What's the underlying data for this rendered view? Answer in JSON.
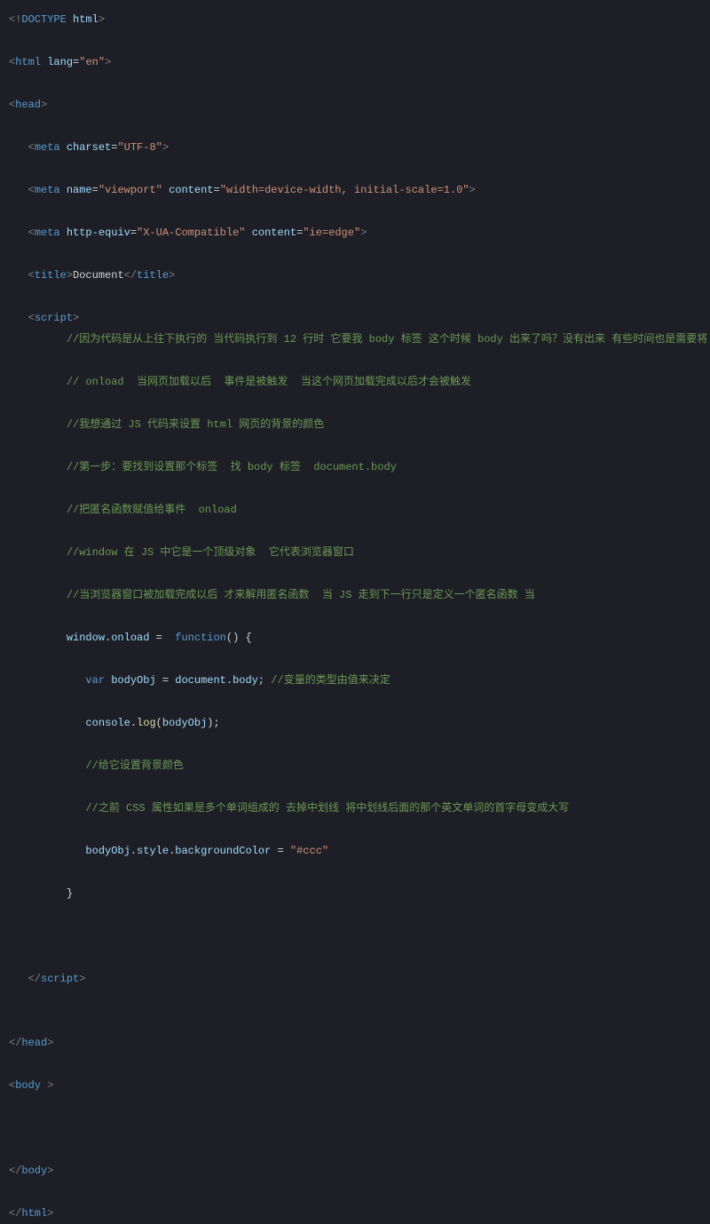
{
  "code": {
    "doctype": "html",
    "html_lang": "en",
    "head": "head",
    "meta1_attr": "charset",
    "meta1_val": "UTF-8",
    "meta2_name": "name",
    "meta2_name_val": "viewport",
    "meta2_content": "content",
    "meta2_content_val": "width=device-width, initial-scale=1.0",
    "meta3_equiv": "http-equiv",
    "meta3_equiv_val": "X-UA-Compatible",
    "meta3_content": "content",
    "meta3_content_val": "ie=edge",
    "title_tag": "title",
    "title_text": "Document",
    "script_tag": "script",
    "comment1": "//因为代码是从上往下执行的 当代码执行到 12 行时 它要我 body 标签 这个时候 body 出来了吗？没有出来 有些时间也是需要将 JS 代码写在 head 这个位置",
    "comment2": "// onload  当网页加载以后  事件是被触发  当这个网页加载完成以后才会被触发",
    "comment3": "//我想通过 JS 代码来设置 html 网页的背景的颜色",
    "comment4": "//第一步：要找到设置那个标签  找 body 标签  document.body",
    "comment5": "//把匿名函数赋值给事件  onload",
    "comment6": "//window 在 JS 中它是一个顶级对象  它代表浏览器窗口",
    "comment7": "//当浏览器窗口被加载完成以后 才来解用匿名函数  当 JS 走到下一行只是定义一个匿名函数 当",
    "window": "window",
    "onload": "onload",
    "function": "function",
    "var": "var",
    "bodyObj": "bodyObj",
    "document": "document",
    "body_prop": "body",
    "comment8": "//变量的类型由值来决定",
    "console": "console",
    "log": "log",
    "comment9": "//给它设置背景颜色",
    "comment10": "//之前 CSS 属性如果是多个单词组成的 去掉中划线 将中划线后面的那个英文单词的首字母变成大写",
    "style": "style",
    "bgColor": "backgroundColor",
    "color_val": "\"#ccc\"",
    "body_tag": "body",
    "html_tag": "html",
    "meta": "meta"
  }
}
